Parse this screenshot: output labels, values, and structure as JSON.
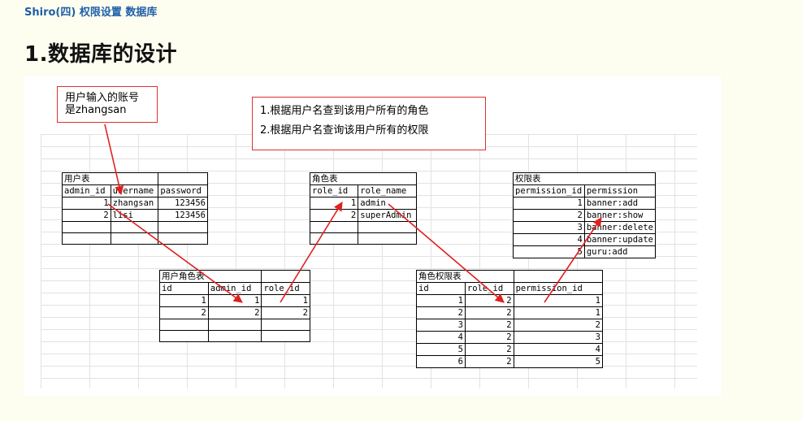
{
  "page_title": "Shiro(四) 权限设置 数据库",
  "section_heading": "1.数据库的设计",
  "notes": {
    "user_input": [
      "用户输入的账号",
      "是zhangsan"
    ],
    "steps": [
      "1.根据用户名查到该用户所有的角色",
      "2.根据用户名查询该用户所有的权限"
    ]
  },
  "tables": {
    "user": {
      "caption": "用户表",
      "headers": [
        "admin_id",
        "username",
        "password"
      ],
      "rows": [
        [
          "1",
          "zhangsan",
          "123456"
        ],
        [
          "2",
          "lisi",
          "123456"
        ],
        [
          "",
          "",
          ""
        ],
        [
          "",
          "",
          ""
        ]
      ]
    },
    "role": {
      "caption": "角色表",
      "headers": [
        "role_id",
        "role_name"
      ],
      "rows": [
        [
          "1",
          "admin"
        ],
        [
          "2",
          "superAdmin"
        ],
        [
          "",
          ""
        ],
        [
          "",
          ""
        ]
      ]
    },
    "permission": {
      "caption": "权限表",
      "headers": [
        "permission_id",
        "permission"
      ],
      "rows": [
        [
          "1",
          "banner:add"
        ],
        [
          "2",
          "banner:show"
        ],
        [
          "3",
          "banner:delete"
        ],
        [
          "4",
          "banner:update"
        ],
        [
          "5",
          "guru:add"
        ]
      ]
    },
    "user_role": {
      "caption": "用户角色表",
      "headers": [
        "id",
        "admin_id",
        "role_id"
      ],
      "rows": [
        [
          "1",
          "1",
          "1"
        ],
        [
          "2",
          "2",
          "2"
        ],
        [
          "",
          "",
          ""
        ],
        [
          "",
          "",
          ""
        ]
      ]
    },
    "role_permission": {
      "caption": "角色权限表",
      "headers": [
        "id",
        "role_id",
        "permission_id"
      ],
      "rows": [
        [
          "1",
          "2",
          "1"
        ],
        [
          "2",
          "2",
          "1"
        ],
        [
          "3",
          "2",
          "2"
        ],
        [
          "4",
          "2",
          "3"
        ],
        [
          "5",
          "2",
          "4"
        ],
        [
          "6",
          "2",
          "5"
        ]
      ]
    }
  },
  "colors": {
    "title": "#1f5fa8",
    "arrow": "#e02020",
    "background": "#fdfdf0"
  }
}
